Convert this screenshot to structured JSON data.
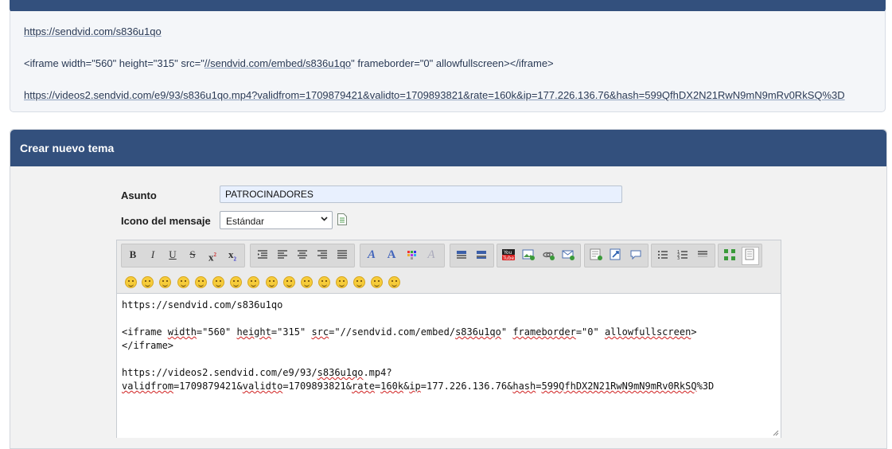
{
  "post": {
    "line1": "https://sendvid.com/s836u1qo",
    "line2_a": "<iframe width=\"560\" height=\"315\" src=\"",
    "line2_link": "//sendvid.com/embed/s836u1qo",
    "line2_b": "\" frameborder=\"0\" allowfullscreen></iframe>",
    "line3": "https://videos2.sendvid.com/e9/93/s836u1qo.mp4?validfrom=1709879421&validto=1709893821&rate=160k&ip=177.226.136.76&hash=599QfhDX2N21RwN9mN9mRv0RkSQ%3D"
  },
  "panel": {
    "title": "Crear nuevo tema"
  },
  "form": {
    "subject_label": "Asunto",
    "subject_value": "PATROCINADORES",
    "icon_label": "Icono del mensaje",
    "icon_selected": "Estándar"
  },
  "toolbar": {
    "bold": "B",
    "italic": "I",
    "underline": "U",
    "strike": "S",
    "sup": "x",
    "sub": "x",
    "icons": [
      "bold-icon",
      "italic-icon",
      "underline-icon",
      "strikethrough-icon",
      "superscript-icon",
      "subscript-icon",
      "indent-icon",
      "align-left-icon",
      "align-center-icon",
      "align-right-icon",
      "align-justify-icon",
      "font-icon",
      "font-size-icon",
      "color-icon",
      "clear-format-icon",
      "table-icon",
      "hr-icon",
      "youtube-icon",
      "image-icon",
      "link-icon",
      "email-icon",
      "code-icon",
      "quote-icon",
      "spoiler-icon",
      "bullet-list-icon",
      "numbered-list-icon",
      "horizontal-rule-icon",
      "fullscreen-icon",
      "source-icon"
    ]
  },
  "smileys": [
    "smile",
    "wink",
    "grin",
    "laugh",
    "cool",
    "smirk",
    "shocked",
    "sunglasses",
    "confused",
    "blush",
    "surprised",
    "tongue",
    "teeth",
    "happy",
    "kiss",
    "giggle"
  ],
  "editor": {
    "l1": "https://sendvid.com/s836u1qo",
    "l2_a": "<iframe ",
    "l2_b": "width",
    "l2_c": "=\"560\" ",
    "l2_d": "height",
    "l2_e": "=\"315\" ",
    "l2_f": "src",
    "l2_g": "=\"//sendvid.com/embed/",
    "l2_h": "s836u1qo",
    "l2_i": "\" ",
    "l2_j": "frameborder",
    "l2_k": "=\"0\" ",
    "l2_l": "allowfullscreen",
    "l2_m": ">",
    "l3": "</iframe>",
    "l4_a": "https://videos2.sendvid.com/e9/93/",
    "l4_b": "s836u1qo",
    "l4_c": ".mp4?",
    "l5_a": "validfrom",
    "l5_b": "=1709879421&",
    "l5_c": "validto",
    "l5_d": "=1709893821&",
    "l5_e": "rate",
    "l5_f": "=",
    "l5_g": "160k",
    "l5_h": "&",
    "l5_i": "ip",
    "l5_j": "=177.226.136.76&",
    "l5_k": "hash",
    "l5_l": "=",
    "l5_m": "599QfhDX2N21RwN9mN9mRv0RkSQ",
    "l5_n": "%3D"
  },
  "colors": {
    "header_blue": "#33507d",
    "input_fill": "#e8f0fe"
  }
}
